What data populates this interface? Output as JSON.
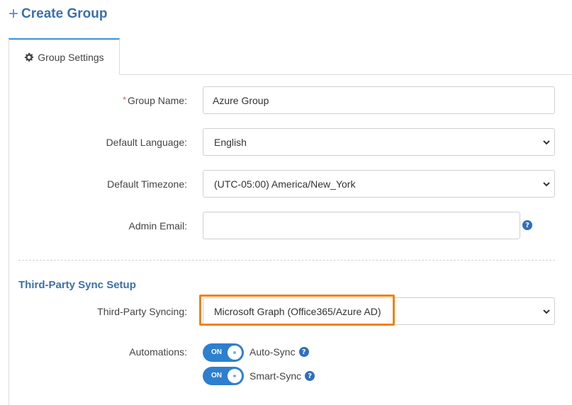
{
  "header": {
    "plus_symbol": "+",
    "title": "Create Group"
  },
  "tabs": [
    {
      "label": "Group Settings",
      "icon": "gear-icon",
      "active": true
    }
  ],
  "form": {
    "group_name": {
      "label": "Group Name:",
      "required_mark": "*",
      "value": "Azure Group"
    },
    "default_language": {
      "label": "Default Language:",
      "value": "English"
    },
    "default_timezone": {
      "label": "Default Timezone:",
      "value": "(UTC-05:00) America/New_York"
    },
    "admin_email": {
      "label": "Admin Email:",
      "value": "",
      "help": "?"
    }
  },
  "sync": {
    "section_title": "Third-Party Sync Setup",
    "third_party_syncing": {
      "label": "Third-Party Syncing:",
      "value": "Microsoft Graph (Office365/Azure AD)"
    },
    "automations": {
      "label": "Automations:",
      "items": [
        {
          "name": "Auto-Sync",
          "state": "ON",
          "help": "?"
        },
        {
          "name": "Smart-Sync",
          "state": "ON",
          "help": "?"
        }
      ]
    }
  },
  "colors": {
    "accent": "#3b6fb0",
    "toggle": "#2e7fd0",
    "highlight": "#f0820f",
    "required": "#d9534f"
  }
}
